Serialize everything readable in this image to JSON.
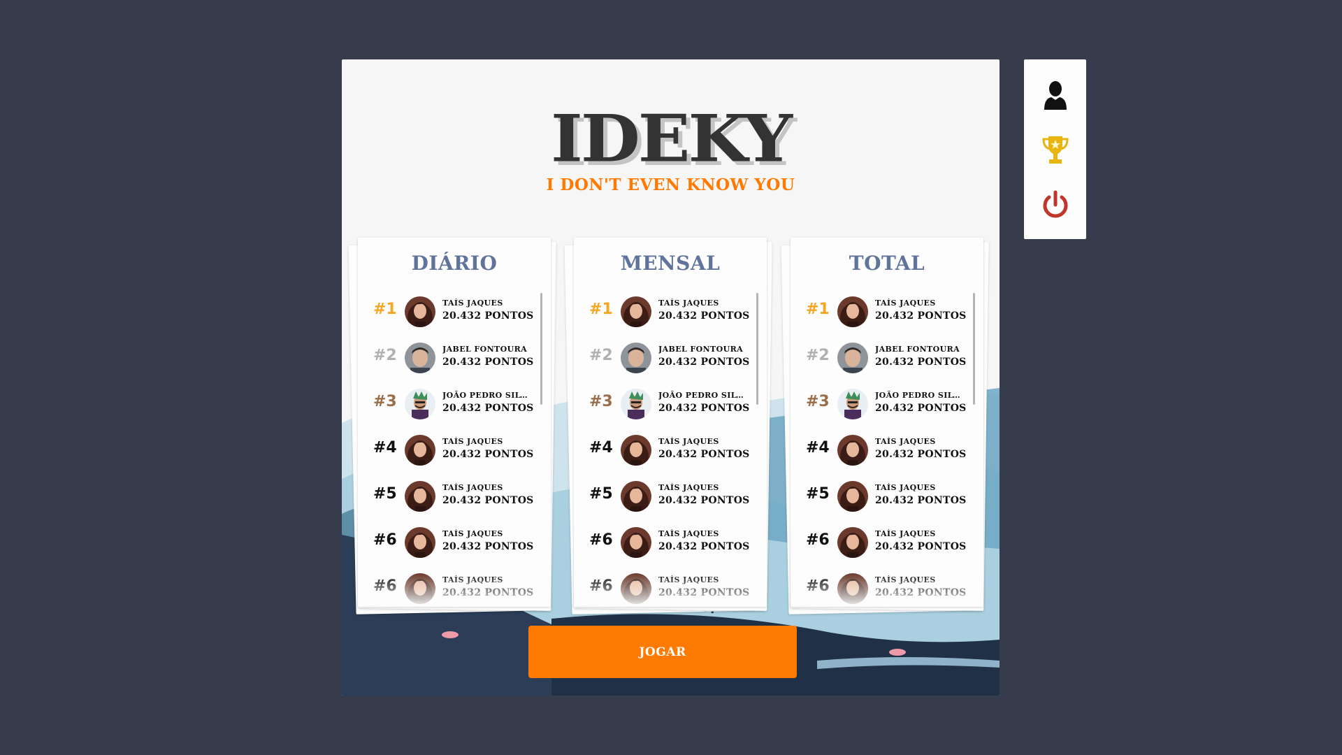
{
  "game": {
    "logo_title": "IDEKY",
    "logo_subtitle": "I DON'T EVEN KNOW YOU",
    "play_button": "JOGAR"
  },
  "colors": {
    "background": "#363c4c",
    "accent": "#ff7a00",
    "board_title": "#5f739b",
    "rank_gold": "#f5a623",
    "rank_silver": "#b0b0b0",
    "rank_bronze": "#9a6e4a",
    "trophy": "#e8b40e",
    "power": "#c1352b"
  },
  "side_menu": [
    {
      "icon": "user-icon"
    },
    {
      "icon": "trophy-icon"
    },
    {
      "icon": "power-icon"
    }
  ],
  "leaderboards": [
    {
      "title": "DIÁRIO",
      "entries": [
        {
          "rank": "#1",
          "name": "TAÍS JAQUES",
          "score": "20.432 PONTOS",
          "avatar": "avatar-woman"
        },
        {
          "rank": "#2",
          "name": "JABEL FONTOURA",
          "score": "20.432 PONTOS",
          "avatar": "avatar-man"
        },
        {
          "rank": "#3",
          "name": "JOÃO PEDRO SILV...",
          "score": "20.432 PONTOS",
          "avatar": "avatar-cartoon"
        },
        {
          "rank": "#4",
          "name": "TAÍS JAQUES",
          "score": "20.432 PONTOS",
          "avatar": "avatar-woman"
        },
        {
          "rank": "#5",
          "name": "TAÍS JAQUES",
          "score": "20.432 PONTOS",
          "avatar": "avatar-woman"
        },
        {
          "rank": "#6",
          "name": "TAÍS JAQUES",
          "score": "20.432 PONTOS",
          "avatar": "avatar-woman"
        },
        {
          "rank": "#6",
          "name": "TAÍS JAQUES",
          "score": "20.432 PONTOS",
          "avatar": "avatar-woman"
        }
      ]
    },
    {
      "title": "MENSAL",
      "entries": [
        {
          "rank": "#1",
          "name": "TAÍS JAQUES",
          "score": "20.432 PONTOS",
          "avatar": "avatar-woman"
        },
        {
          "rank": "#2",
          "name": "JABEL FONTOURA",
          "score": "20.432 PONTOS",
          "avatar": "avatar-man"
        },
        {
          "rank": "#3",
          "name": "JOÃO PEDRO SILV...",
          "score": "20.432 PONTOS",
          "avatar": "avatar-cartoon"
        },
        {
          "rank": "#4",
          "name": "TAÍS JAQUES",
          "score": "20.432 PONTOS",
          "avatar": "avatar-woman"
        },
        {
          "rank": "#5",
          "name": "TAÍS JAQUES",
          "score": "20.432 PONTOS",
          "avatar": "avatar-woman"
        },
        {
          "rank": "#6",
          "name": "TAÍS JAQUES",
          "score": "20.432 PONTOS",
          "avatar": "avatar-woman"
        },
        {
          "rank": "#6",
          "name": "TAÍS JAQUES",
          "score": "20.432 PONTOS",
          "avatar": "avatar-woman"
        }
      ]
    },
    {
      "title": "TOTAL",
      "entries": [
        {
          "rank": "#1",
          "name": "TAÍS JAQUES",
          "score": "20.432 PONTOS",
          "avatar": "avatar-woman"
        },
        {
          "rank": "#2",
          "name": "JABEL FONTOURA",
          "score": "20.432 PONTOS",
          "avatar": "avatar-man"
        },
        {
          "rank": "#3",
          "name": "JOÃO PEDRO SILV...",
          "score": "20.432 PONTOS",
          "avatar": "avatar-cartoon"
        },
        {
          "rank": "#4",
          "name": "TAÍS JAQUES",
          "score": "20.432 PONTOS",
          "avatar": "avatar-woman"
        },
        {
          "rank": "#5",
          "name": "TAÍS JAQUES",
          "score": "20.432 PONTOS",
          "avatar": "avatar-woman"
        },
        {
          "rank": "#6",
          "name": "TAÍS JAQUES",
          "score": "20.432 PONTOS",
          "avatar": "avatar-woman"
        },
        {
          "rank": "#6",
          "name": "TAÍS JAQUES",
          "score": "20.432 PONTOS",
          "avatar": "avatar-woman"
        }
      ]
    }
  ]
}
